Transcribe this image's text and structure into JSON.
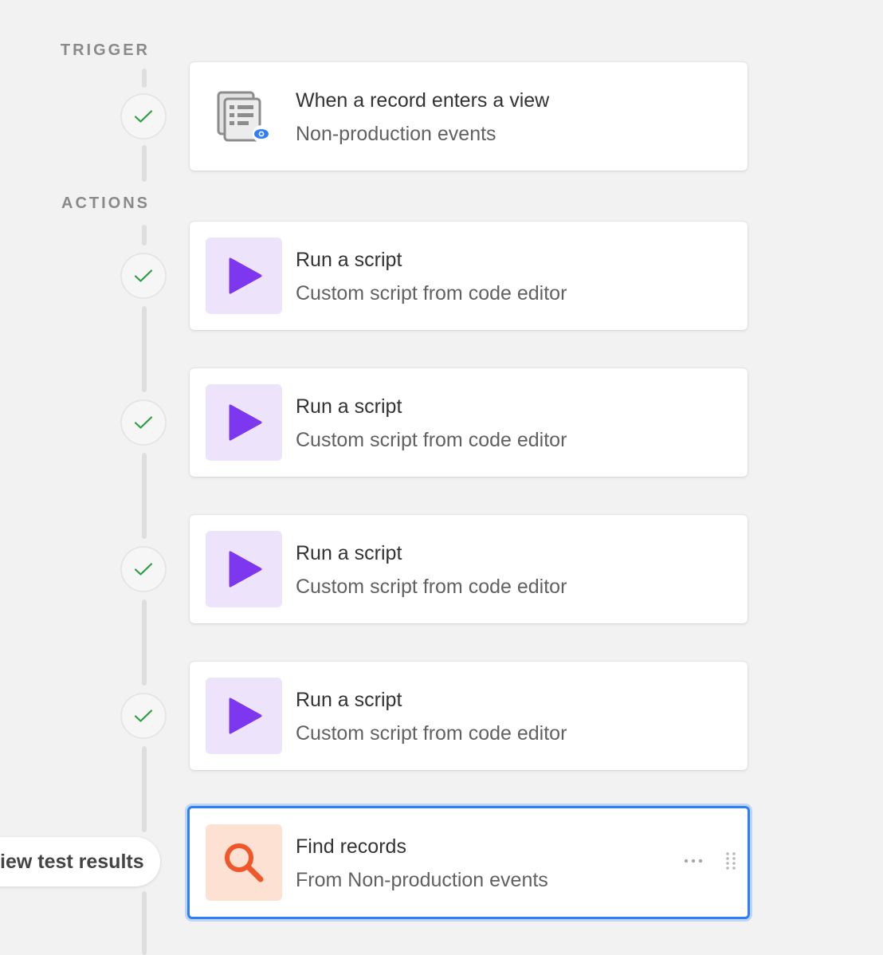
{
  "sections": {
    "trigger_label": "TRIGGER",
    "actions_label": "ACTIONS"
  },
  "trigger": {
    "title": "When a record enters a view",
    "subtitle": "Non-production events",
    "icon": "record-view-icon",
    "status": "success"
  },
  "actions": [
    {
      "title": "Run a script",
      "subtitle": "Custom script from code editor",
      "icon": "play-icon",
      "status": "success"
    },
    {
      "title": "Run a script",
      "subtitle": "Custom script from code editor",
      "icon": "play-icon",
      "status": "success"
    },
    {
      "title": "Run a script",
      "subtitle": "Custom script from code editor",
      "icon": "play-icon",
      "status": "success"
    },
    {
      "title": "Run a script",
      "subtitle": "Custom script from code editor",
      "icon": "play-icon",
      "status": "success"
    },
    {
      "title": "Find records",
      "subtitle": "From Non-production events",
      "icon": "search-icon",
      "status": "selected"
    }
  ],
  "test_results_button": "iew test results",
  "colors": {
    "background": "#f2f2f2",
    "check": "#2e9e3e",
    "script_purple": "#7c37ef",
    "script_bg": "#ede4fb",
    "find_orange": "#f0572b",
    "find_bg": "#fde2d4",
    "selected_border": "#2d7ff9"
  }
}
